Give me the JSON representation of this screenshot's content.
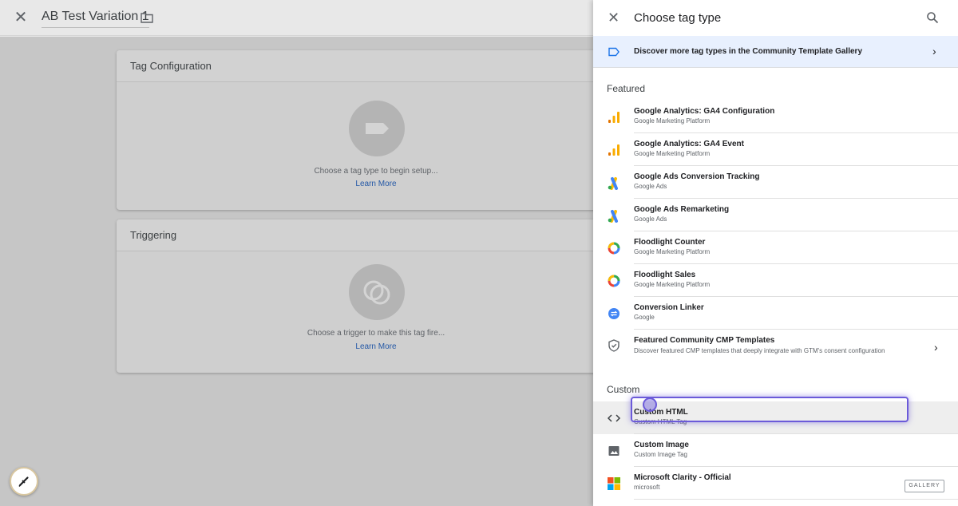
{
  "editor": {
    "title": "AB Test Variation 1",
    "tag_config": {
      "header": "Tag Configuration",
      "hint": "Choose a tag type to begin setup...",
      "link": "Learn More"
    },
    "triggering": {
      "header": "Triggering",
      "hint": "Choose a trigger to make this tag fire...",
      "link": "Learn More"
    }
  },
  "panel": {
    "title": "Choose tag type",
    "banner": "Discover more tag types in the Community Template Gallery",
    "featured_title": "Featured",
    "featured": [
      {
        "name": "Google Analytics: GA4 Configuration",
        "sub": "Google Marketing Platform",
        "icon": "analytics-icon"
      },
      {
        "name": "Google Analytics: GA4 Event",
        "sub": "Google Marketing Platform",
        "icon": "analytics-icon"
      },
      {
        "name": "Google Ads Conversion Tracking",
        "sub": "Google Ads",
        "icon": "google-ads-icon"
      },
      {
        "name": "Google Ads Remarketing",
        "sub": "Google Ads",
        "icon": "google-ads-icon"
      },
      {
        "name": "Floodlight Counter",
        "sub": "Google Marketing Platform",
        "icon": "floodlight-icon"
      },
      {
        "name": "Floodlight Sales",
        "sub": "Google Marketing Platform",
        "icon": "floodlight-icon"
      },
      {
        "name": "Conversion Linker",
        "sub": "Google",
        "icon": "conversion-linker-icon"
      },
      {
        "name": "Featured Community CMP Templates",
        "sub": "Discover featured CMP templates that deeply integrate with GTM's consent configuration",
        "icon": "shield-icon"
      }
    ],
    "custom_title": "Custom",
    "custom": [
      {
        "name": "Custom HTML",
        "sub": "Custom HTML Tag",
        "icon": "code-icon"
      },
      {
        "name": "Custom Image",
        "sub": "Custom Image Tag",
        "icon": "image-icon"
      },
      {
        "name": "Microsoft Clarity - Official",
        "sub": "microsoft",
        "icon": "microsoft-icon",
        "badge": "GALLERY"
      }
    ]
  },
  "colors": {
    "accent": "#1a73e8",
    "focus": "#6b5ad9",
    "ga_orange": "#f9ab00",
    "ads_blue": "#4285f4",
    "ads_yellow": "#fbbc04",
    "ads_green": "#34a853"
  }
}
